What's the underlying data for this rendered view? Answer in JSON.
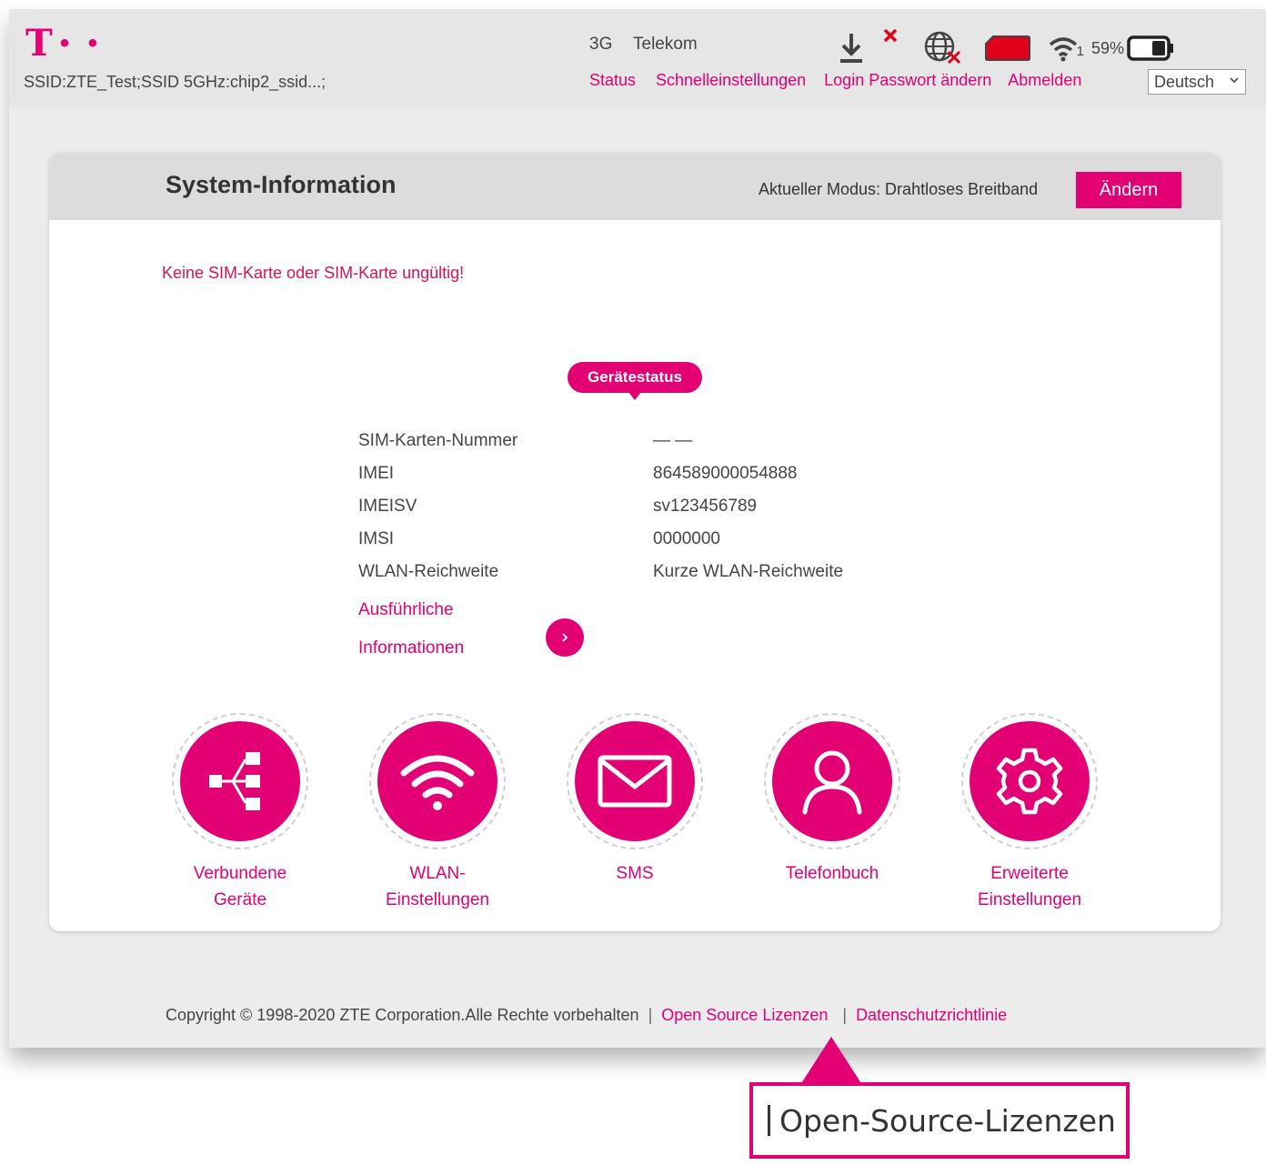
{
  "header": {
    "logo": "T",
    "logo_dots": "• •",
    "ssid": "SSID:ZTE_Test;SSID 5GHz:chip2_ssid...;",
    "network_type": "3G",
    "carrier": "Telekom",
    "wifi_clients": "1",
    "battery_percent": "59%",
    "nav": {
      "status": "Status",
      "quick_settings": "Schnelleinstellungen",
      "change_login_password": "Login Passwort ändern",
      "logout": "Abmelden"
    },
    "language": "Deutsch"
  },
  "card": {
    "title": "System-Information",
    "mode_text": "Aktueller Modus: Drahtloses Breitband",
    "change_button": "Ändern",
    "sim_warning": "Keine SIM-Karte oder SIM-Karte ungültig!",
    "device_status_badge": "Gerätestatus",
    "info": [
      {
        "label": "SIM-Karten-Nummer",
        "value": "— —"
      },
      {
        "label": "IMEI",
        "value": "864589000054888"
      },
      {
        "label": "IMEISV",
        "value": "sv123456789"
      },
      {
        "label": "IMSI",
        "value": "0000000"
      },
      {
        "label": "WLAN-Reichweite",
        "value": "Kurze WLAN-Reichweite"
      }
    ],
    "details_link_line1": "Ausführliche",
    "details_link_line2": "Informationen",
    "tiles": [
      {
        "line1": "Verbundene",
        "line2": "Geräte",
        "icon": "connected-devices-icon"
      },
      {
        "line1": "WLAN-",
        "line2": "Einstellungen",
        "icon": "wifi-icon"
      },
      {
        "line1": "SMS",
        "line2": "",
        "icon": "envelope-icon"
      },
      {
        "line1": "Telefonbuch",
        "line2": "",
        "icon": "person-icon"
      },
      {
        "line1": "Erweiterte",
        "line2": "Einstellungen",
        "icon": "gear-icon"
      }
    ]
  },
  "footer": {
    "copyright": "Copyright © 1998-2020 ZTE Corporation.Alle Rechte vorbehalten",
    "sep": "|",
    "open_source": "Open Source Lizenzen",
    "privacy": "Datenschutzrichtlinie"
  },
  "callout": {
    "text": "Open-Source-Lizenzen"
  },
  "colors": {
    "brand": "#e20074",
    "header_bg": "#e6e6e6",
    "card_head_bg": "#dcdcdc"
  }
}
